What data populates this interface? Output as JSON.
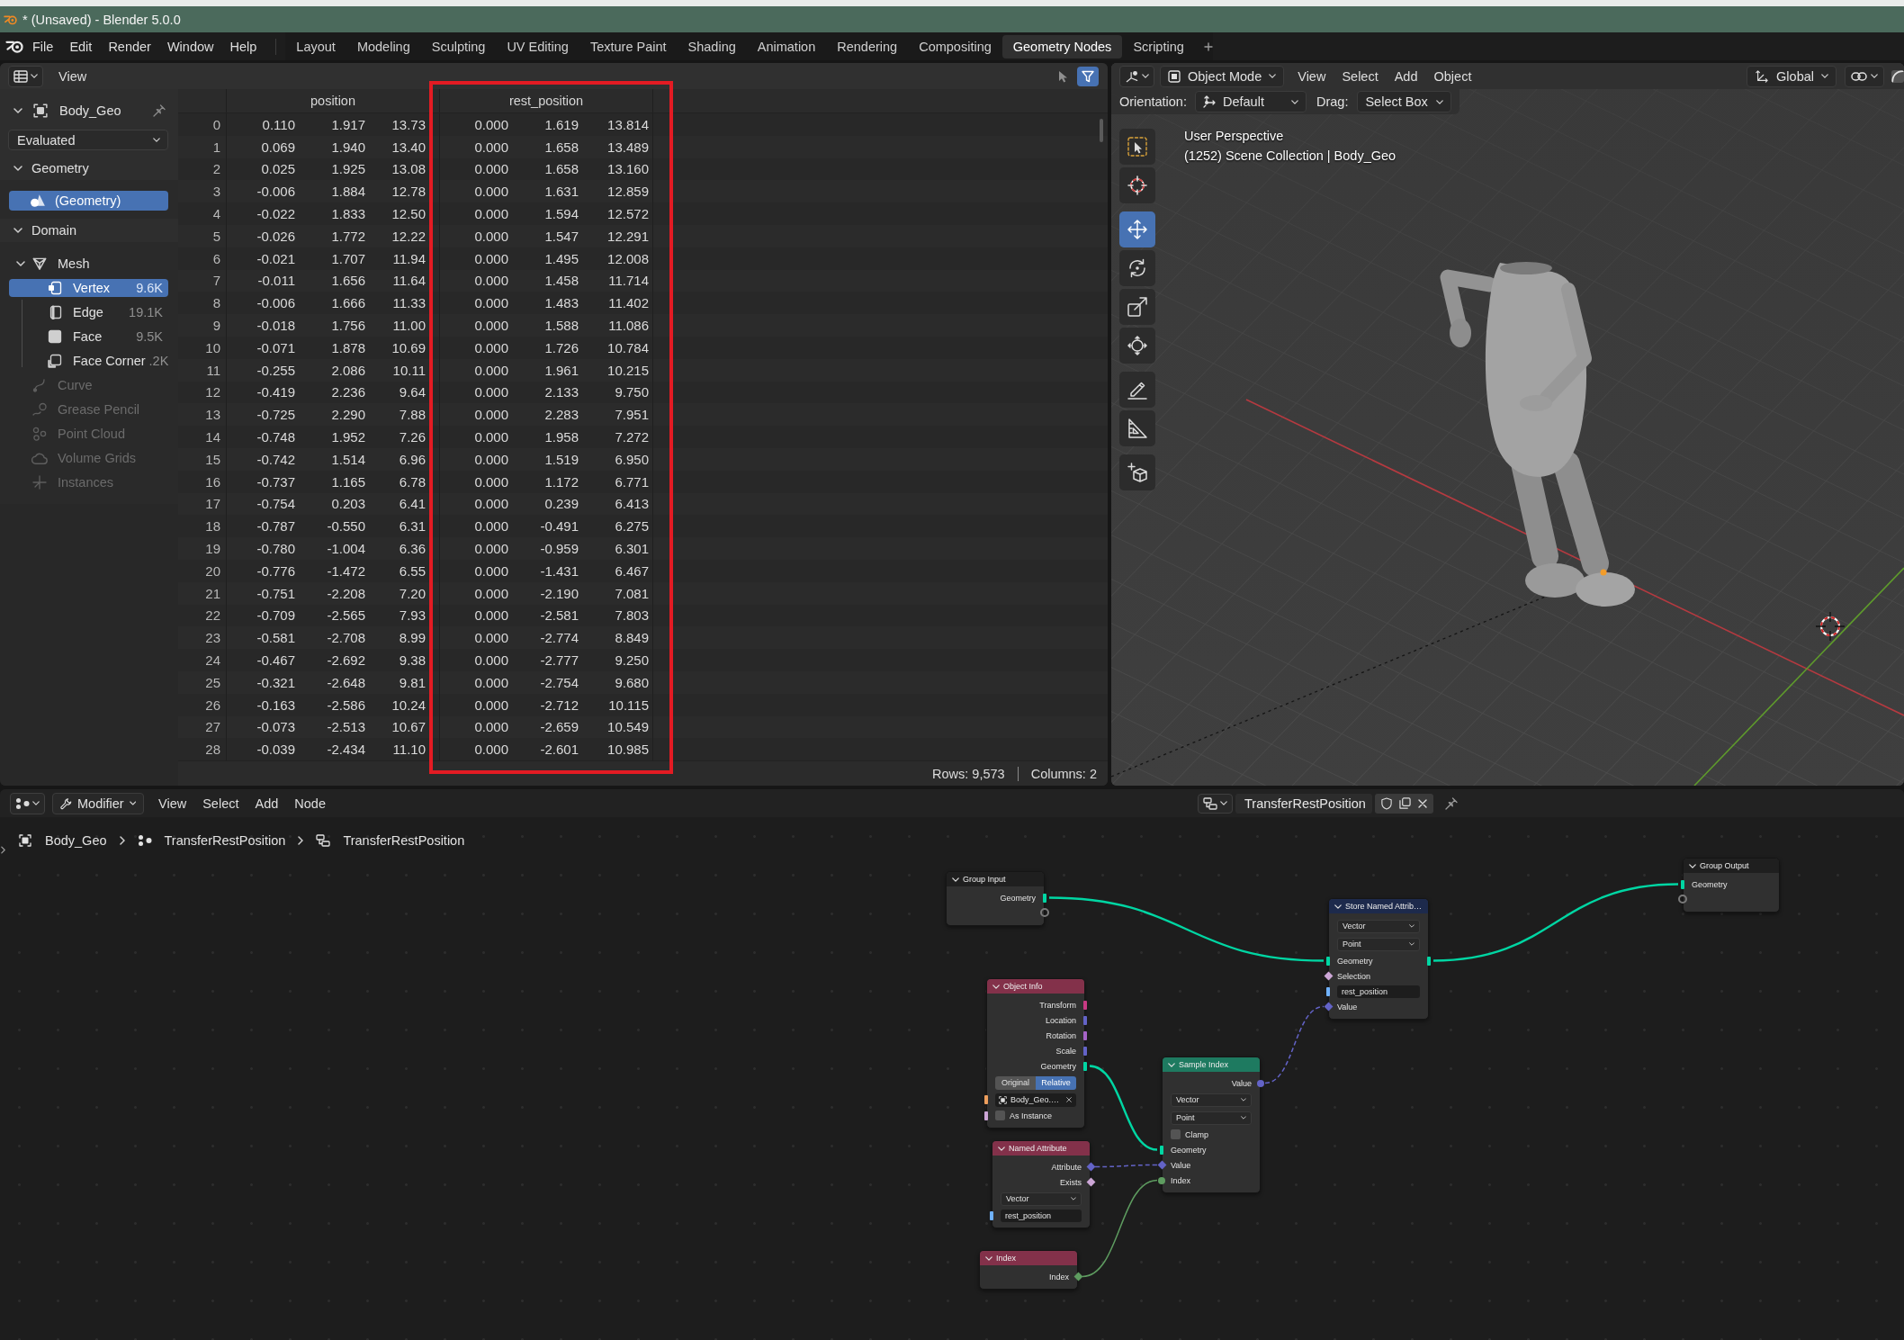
{
  "window": {
    "title": "* (Unsaved) - Blender 5.0.0"
  },
  "menu_bar": {
    "menus": [
      "File",
      "Edit",
      "Render",
      "Window",
      "Help"
    ],
    "workspaces": [
      {
        "label": "Layout",
        "selected": false
      },
      {
        "label": "Modeling",
        "selected": false
      },
      {
        "label": "Sculpting",
        "selected": false
      },
      {
        "label": "UV Editing",
        "selected": false
      },
      {
        "label": "Texture Paint",
        "selected": false
      },
      {
        "label": "Shading",
        "selected": false
      },
      {
        "label": "Animation",
        "selected": false
      },
      {
        "label": "Rendering",
        "selected": false
      },
      {
        "label": "Compositing",
        "selected": false
      },
      {
        "label": "Geometry Nodes",
        "selected": true
      },
      {
        "label": "Scripting",
        "selected": false
      }
    ]
  },
  "spreadsheet": {
    "header": {
      "menus": [
        "View"
      ],
      "selected_only": false,
      "use_filter": true
    },
    "sidebar": {
      "object": "Body_Geo",
      "evaluation": "Evaluated",
      "geometry_panel": {
        "title": "Geometry",
        "expanded": true,
        "items": [
          {
            "label": "(Geometry)",
            "selected": true
          }
        ]
      },
      "domain_panel": {
        "title": "Domain",
        "expanded": true,
        "items": [
          {
            "label": "Mesh",
            "disabled": false,
            "expanded": true,
            "children": [
              {
                "label": "Vertex",
                "count": "9.6K",
                "selected": true
              },
              {
                "label": "Edge",
                "count": "19.1K",
                "selected": false
              },
              {
                "label": "Face",
                "count": "9.5K",
                "selected": false
              },
              {
                "label": "Face Corner",
                "count": ".2K",
                "selected": false
              }
            ]
          },
          {
            "label": "Curve",
            "disabled": true
          },
          {
            "label": "Grease Pencil",
            "disabled": true
          },
          {
            "label": "Point Cloud",
            "disabled": true
          },
          {
            "label": "Volume Grids",
            "disabled": true
          },
          {
            "label": "Instances",
            "disabled": true
          }
        ]
      }
    },
    "table": {
      "columns": [
        {
          "name": "position",
          "highlighted": false
        },
        {
          "name": "rest_position",
          "highlighted": true
        }
      ],
      "rows": [
        {
          "index": "0",
          "cells": [
            [
              "0.110",
              "1.917",
              "13.73"
            ],
            [
              "0.000",
              "1.619",
              "13.814"
            ]
          ]
        },
        {
          "index": "1",
          "cells": [
            [
              "0.069",
              "1.940",
              "13.40"
            ],
            [
              "0.000",
              "1.658",
              "13.489"
            ]
          ]
        },
        {
          "index": "2",
          "cells": [
            [
              "0.025",
              "1.925",
              "13.08"
            ],
            [
              "0.000",
              "1.658",
              "13.160"
            ]
          ]
        },
        {
          "index": "3",
          "cells": [
            [
              "-0.006",
              "1.884",
              "12.78"
            ],
            [
              "0.000",
              "1.631",
              "12.859"
            ]
          ]
        },
        {
          "index": "4",
          "cells": [
            [
              "-0.022",
              "1.833",
              "12.50"
            ],
            [
              "0.000",
              "1.594",
              "12.572"
            ]
          ]
        },
        {
          "index": "5",
          "cells": [
            [
              "-0.026",
              "1.772",
              "12.22"
            ],
            [
              "0.000",
              "1.547",
              "12.291"
            ]
          ]
        },
        {
          "index": "6",
          "cells": [
            [
              "-0.021",
              "1.707",
              "11.94"
            ],
            [
              "0.000",
              "1.495",
              "12.008"
            ]
          ]
        },
        {
          "index": "7",
          "cells": [
            [
              "-0.011",
              "1.656",
              "11.64"
            ],
            [
              "0.000",
              "1.458",
              "11.714"
            ]
          ]
        },
        {
          "index": "8",
          "cells": [
            [
              "-0.006",
              "1.666",
              "11.33"
            ],
            [
              "0.000",
              "1.483",
              "11.402"
            ]
          ]
        },
        {
          "index": "9",
          "cells": [
            [
              "-0.018",
              "1.756",
              "11.00"
            ],
            [
              "0.000",
              "1.588",
              "11.086"
            ]
          ]
        },
        {
          "index": "10",
          "cells": [
            [
              "-0.071",
              "1.878",
              "10.69"
            ],
            [
              "0.000",
              "1.726",
              "10.784"
            ]
          ]
        },
        {
          "index": "11",
          "cells": [
            [
              "-0.255",
              "2.086",
              "10.11"
            ],
            [
              "0.000",
              "1.961",
              "10.215"
            ]
          ]
        },
        {
          "index": "12",
          "cells": [
            [
              "-0.419",
              "2.236",
              "9.64"
            ],
            [
              "0.000",
              "2.133",
              "9.750"
            ]
          ]
        },
        {
          "index": "13",
          "cells": [
            [
              "-0.725",
              "2.290",
              "7.88"
            ],
            [
              "0.000",
              "2.283",
              "7.951"
            ]
          ]
        },
        {
          "index": "14",
          "cells": [
            [
              "-0.748",
              "1.952",
              "7.26"
            ],
            [
              "0.000",
              "1.958",
              "7.272"
            ]
          ]
        },
        {
          "index": "15",
          "cells": [
            [
              "-0.742",
              "1.514",
              "6.96"
            ],
            [
              "0.000",
              "1.519",
              "6.950"
            ]
          ]
        },
        {
          "index": "16",
          "cells": [
            [
              "-0.737",
              "1.165",
              "6.78"
            ],
            [
              "0.000",
              "1.172",
              "6.771"
            ]
          ]
        },
        {
          "index": "17",
          "cells": [
            [
              "-0.754",
              "0.203",
              "6.41"
            ],
            [
              "0.000",
              "0.239",
              "6.413"
            ]
          ]
        },
        {
          "index": "18",
          "cells": [
            [
              "-0.787",
              "-0.550",
              "6.31"
            ],
            [
              "0.000",
              "-0.491",
              "6.275"
            ]
          ]
        },
        {
          "index": "19",
          "cells": [
            [
              "-0.780",
              "-1.004",
              "6.36"
            ],
            [
              "0.000",
              "-0.959",
              "6.301"
            ]
          ]
        },
        {
          "index": "20",
          "cells": [
            [
              "-0.776",
              "-1.472",
              "6.55"
            ],
            [
              "0.000",
              "-1.431",
              "6.467"
            ]
          ]
        },
        {
          "index": "21",
          "cells": [
            [
              "-0.751",
              "-2.208",
              "7.20"
            ],
            [
              "0.000",
              "-2.190",
              "7.081"
            ]
          ]
        },
        {
          "index": "22",
          "cells": [
            [
              "-0.709",
              "-2.565",
              "7.93"
            ],
            [
              "0.000",
              "-2.581",
              "7.803"
            ]
          ]
        },
        {
          "index": "23",
          "cells": [
            [
              "-0.581",
              "-2.708",
              "8.99"
            ],
            [
              "0.000",
              "-2.774",
              "8.849"
            ]
          ]
        },
        {
          "index": "24",
          "cells": [
            [
              "-0.467",
              "-2.692",
              "9.38"
            ],
            [
              "0.000",
              "-2.777",
              "9.250"
            ]
          ]
        },
        {
          "index": "25",
          "cells": [
            [
              "-0.321",
              "-2.648",
              "9.81"
            ],
            [
              "0.000",
              "-2.754",
              "9.680"
            ]
          ]
        },
        {
          "index": "26",
          "cells": [
            [
              "-0.163",
              "-2.586",
              "10.24"
            ],
            [
              "0.000",
              "-2.712",
              "10.115"
            ]
          ]
        },
        {
          "index": "27",
          "cells": [
            [
              "-0.073",
              "-2.513",
              "10.67"
            ],
            [
              "0.000",
              "-2.659",
              "10.549"
            ]
          ]
        },
        {
          "index": "28",
          "cells": [
            [
              "-0.039",
              "-2.434",
              "11.10"
            ],
            [
              "0.000",
              "-2.601",
              "10.985"
            ]
          ]
        }
      ]
    },
    "footer": {
      "rows": "Rows: 9,573",
      "columns": "Columns: 2"
    }
  },
  "viewport": {
    "header": {
      "mode": "Object Mode",
      "menus": [
        "View",
        "Select",
        "Add",
        "Object"
      ],
      "orientation": "Global"
    },
    "tool_settings": {
      "orientation_label": "Orientation:",
      "orientation": "Default",
      "drag_label": "Drag:",
      "drag": "Select Box"
    },
    "tools": [
      {
        "selected": false
      },
      {
        "selected": false
      },
      {
        "selected": true
      },
      {
        "selected": false
      },
      {
        "selected": false
      },
      {
        "selected": false
      },
      {
        "selected": false
      },
      {
        "selected": false
      },
      {
        "selected": false
      }
    ],
    "overlay": {
      "view_name": "User Perspective",
      "info": "(1252) Scene Collection | Body_Geo"
    }
  },
  "node_editor": {
    "header": {
      "context": "Modifier",
      "menus": [
        "View",
        "Select",
        "Add",
        "Node"
      ],
      "node_group": "TransferRestPosition"
    },
    "breadcrumbs": [
      "Body_Geo",
      "TransferRestPosition",
      "TransferRestPosition"
    ],
    "nodes": [
      {
        "title": "Group Input",
        "kind": "group",
        "rows": [
          {
            "kind": "output",
            "label": "Geometry",
            "socket": {
              "kind": "bar",
              "color": "#00d6a3"
            }
          },
          {
            "kind": "output",
            "socket": {
              "kind": "hollow",
              "color": "#7a7a7a"
            }
          }
        ]
      },
      {
        "title": "Store Named Attrib…",
        "kind": "attribute",
        "rows": [
          {
            "kind": "dropdown",
            "value": "Vector"
          },
          {
            "kind": "dropdown",
            "value": "Point"
          },
          {
            "kind": "through",
            "label": "Geometry",
            "socket": {
              "kind": "bar",
              "color": "#00d6a3"
            }
          },
          {
            "kind": "input",
            "label": "Selection",
            "socket": {
              "kind": "diamond",
              "color": "#cca6d6"
            }
          },
          {
            "kind": "text_field",
            "value": "rest_position",
            "socket": {
              "kind": "bar",
              "color": "#70b2ff"
            }
          },
          {
            "kind": "input",
            "label": "Value",
            "socket": {
              "kind": "diamond",
              "color": "#6363c7"
            }
          }
        ]
      },
      {
        "title": "Group Output",
        "kind": "group",
        "rows": [
          {
            "kind": "input",
            "label": "Geometry",
            "socket": {
              "kind": "bar",
              "color": "#00d6a3"
            }
          },
          {
            "kind": "input",
            "socket": {
              "kind": "hollow",
              "color": "#7a7a7a"
            }
          }
        ]
      },
      {
        "title": "Object Info",
        "kind": "input",
        "rows": [
          {
            "kind": "output",
            "label": "Transform",
            "socket": {
              "kind": "bar",
              "color": "#c83a84"
            }
          },
          {
            "kind": "output",
            "label": "Location",
            "socket": {
              "kind": "bar",
              "color": "#6363c7"
            }
          },
          {
            "kind": "output",
            "label": "Rotation",
            "socket": {
              "kind": "bar",
              "color": "#a663c7"
            }
          },
          {
            "kind": "output",
            "label": "Scale",
            "socket": {
              "kind": "bar",
              "color": "#6363c7"
            }
          },
          {
            "kind": "output",
            "label": "Geometry",
            "socket": {
              "kind": "bar",
              "color": "#00d6a3"
            }
          },
          {
            "kind": "toggle",
            "options": [
              {
                "label": "Original",
                "selected": false
              },
              {
                "label": "Relative",
                "selected": true
              }
            ]
          },
          {
            "kind": "object_field",
            "value": "Body_Geo.…",
            "socket": {
              "kind": "bar",
              "color": "#ed9e5c"
            }
          },
          {
            "kind": "checkbox",
            "label": "As Instance",
            "checked": false,
            "socket": {
              "kind": "bar",
              "color": "#cca6d6"
            }
          }
        ]
      },
      {
        "title": "Sample Index",
        "kind": "geometry",
        "rows": [
          {
            "kind": "output",
            "label": "Value",
            "socket": {
              "kind": "circle",
              "color": "#6363c7"
            }
          },
          {
            "kind": "dropdown",
            "value": "Vector"
          },
          {
            "kind": "dropdown",
            "value": "Point"
          },
          {
            "kind": "checkbox",
            "label": "Clamp",
            "checked": false
          },
          {
            "kind": "input",
            "label": "Geometry",
            "socket": {
              "kind": "bar",
              "color": "#00d6a3"
            }
          },
          {
            "kind": "input",
            "label": "Value",
            "socket": {
              "kind": "diamond",
              "color": "#6363c7"
            }
          },
          {
            "kind": "input",
            "label": "Index",
            "socket": {
              "kind": "circle",
              "color": "#5e9c60"
            }
          }
        ]
      },
      {
        "title": "Named Attribute",
        "kind": "input",
        "rows": [
          {
            "kind": "output",
            "label": "Attribute",
            "socket": {
              "kind": "diamond",
              "color": "#6363c7"
            }
          },
          {
            "kind": "output",
            "label": "Exists",
            "socket": {
              "kind": "diamond",
              "color": "#cca6d6"
            }
          },
          {
            "kind": "dropdown",
            "value": "Vector"
          },
          {
            "kind": "text_field",
            "value": "rest_position",
            "socket": {
              "kind": "bar",
              "color": "#70b2ff"
            }
          }
        ]
      },
      {
        "title": "Index",
        "kind": "input",
        "rows": [
          {
            "kind": "output",
            "label": "Index",
            "socket": {
              "kind": "diamond",
              "color": "#5e9c60"
            }
          }
        ]
      }
    ]
  }
}
